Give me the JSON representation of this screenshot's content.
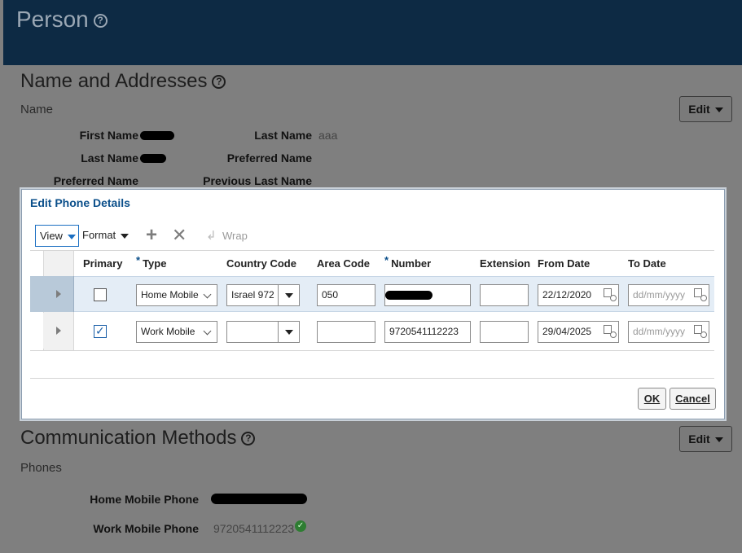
{
  "page": {
    "title": "Person"
  },
  "name_addresses": {
    "title": "Name and Addresses",
    "subtitle": "Name",
    "edit_label": "Edit",
    "fields": {
      "first_name_label": "First Name",
      "last_name_label": "Last Name",
      "last_name_label_2": "Last Name",
      "last_name_value_2": "aaa",
      "preferred_name_label": "Preferred Name",
      "preferred_name_label_2": "Preferred Name",
      "previous_last_name_label": "Previous Last Name"
    }
  },
  "dialog": {
    "title": "Edit Phone Details",
    "toolbar": {
      "view_label": "View",
      "format_label": "Format",
      "add_icon": "plus-icon",
      "delete_icon": "x-icon",
      "wrap_label": "Wrap"
    },
    "columns": {
      "primary": "Primary",
      "type": "Type",
      "country_code": "Country Code",
      "area_code": "Area Code",
      "number": "Number",
      "extension": "Extension",
      "from_date": "From Date",
      "to_date": "To Date",
      "required_marker": "*"
    },
    "rows": [
      {
        "primary": false,
        "type": "Home Mobile",
        "country_code": "Israel 972",
        "area_code": "050",
        "number": "",
        "extension": "",
        "from_date": "22/12/2020",
        "to_date_placeholder": "dd/mm/yyyy"
      },
      {
        "primary": true,
        "type": "Work Mobile",
        "country_code": "",
        "area_code": "",
        "number": "9720541112223",
        "extension": "",
        "from_date": "29/04/2025",
        "to_date_placeholder": "dd/mm/yyyy"
      }
    ],
    "ok_label": "OK",
    "cancel_label": "Cancel"
  },
  "communication": {
    "title": "Communication Methods",
    "subtitle": "Phones",
    "edit_label": "Edit",
    "home_label": "Home Mobile Phone",
    "work_label": "Work Mobile Phone",
    "work_value": "9720541112223"
  },
  "colors": {
    "header_bg": "#0d2a44",
    "overlay_bg": "#7f7f7f",
    "accent": "#0b4f8a",
    "success": "#2e7d32"
  }
}
